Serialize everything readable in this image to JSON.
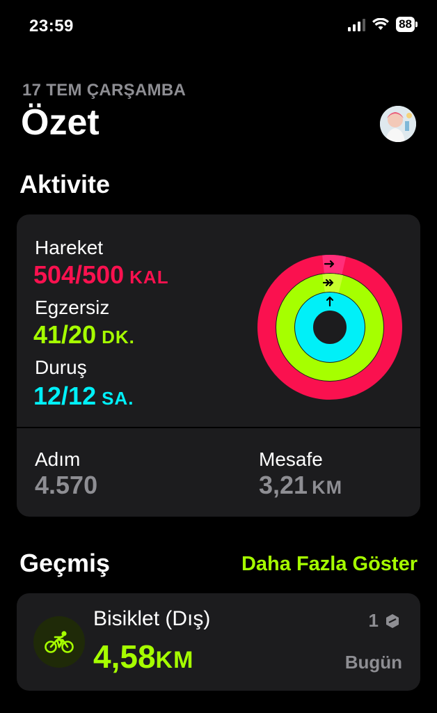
{
  "status_bar": {
    "time": "23:59",
    "battery": "88"
  },
  "header": {
    "date": "17 TEM ÇARŞAMBA",
    "title": "Özet"
  },
  "activity": {
    "title": "Aktivite",
    "move": {
      "label": "Hareket",
      "value": "504/500",
      "unit": "KAL",
      "progress": 1.008
    },
    "exercise": {
      "label": "Egzersiz",
      "value": "41/20",
      "unit": "DK.",
      "progress": 2.05
    },
    "stand": {
      "label": "Duruş",
      "value": "12/12",
      "unit": "SA.",
      "progress": 1.0
    },
    "steps": {
      "label": "Adım",
      "value": "4.570"
    },
    "distance": {
      "label": "Mesafe",
      "value": "3,21",
      "unit": "KM"
    },
    "colors": {
      "move": "#fa114f",
      "exercise": "#a6ff00",
      "stand": "#00f0f8"
    }
  },
  "history": {
    "title": "Geçmiş",
    "show_more": "Daha Fazla Göster",
    "items": [
      {
        "name": "Bisiklet (Dış)",
        "value": "4,58",
        "unit": "KM",
        "count": "1",
        "date": "Bugün",
        "icon": "bicycle-icon"
      }
    ]
  }
}
